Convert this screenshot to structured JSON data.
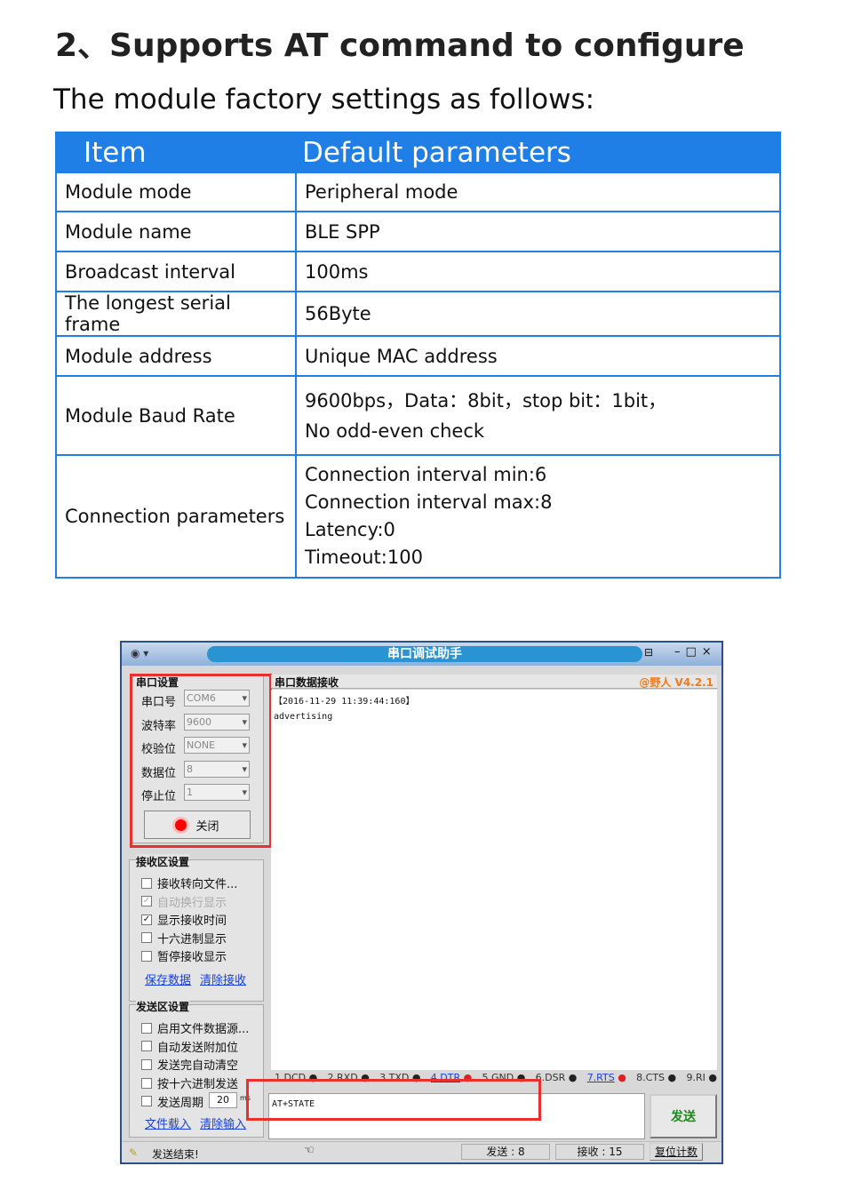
{
  "heading": "2、Supports AT command to configure",
  "subheading": "The module factory settings as follows:",
  "table": {
    "headers": [
      "Item",
      "Default parameters"
    ],
    "rows": [
      {
        "item": "Module mode",
        "value": [
          "Peripheral mode"
        ]
      },
      {
        "item": "Module name",
        "value": [
          "BLE SPP"
        ]
      },
      {
        "item": "Broadcast interval",
        "value": [
          "100ms"
        ]
      },
      {
        "item": "The longest serial frame",
        "value": [
          "56Byte"
        ]
      },
      {
        "item": "Module address",
        "value": [
          "Unique MAC address"
        ]
      },
      {
        "item": "Module Baud Rate",
        "value": [
          "9600bps，Data：8bit，stop bit：1bit，",
          "No odd-even check"
        ]
      },
      {
        "item": "Connection parameters",
        "value": [
          "Connection interval min:6",
          "Connection interval max:8",
          "Latency:0",
          "Timeout:100"
        ]
      }
    ]
  },
  "app": {
    "title": "串口调试助手",
    "version": "@野人 V4.2.1",
    "serial_group": "串口设置",
    "serial_fields": [
      {
        "label": "串口号",
        "value": "COM6"
      },
      {
        "label": "波特率",
        "value": "9600"
      },
      {
        "label": "校验位",
        "value": "NONE"
      },
      {
        "label": "数据位",
        "value": "8"
      },
      {
        "label": "停止位",
        "value": "1"
      }
    ],
    "close_button": "关闭",
    "receive_group": "接收区设置",
    "receive_options": [
      {
        "label": "接收转向文件...",
        "checked": false,
        "disabled": false
      },
      {
        "label": "自动换行显示",
        "checked": true,
        "disabled": true
      },
      {
        "label": "显示接收时间",
        "checked": true,
        "disabled": false
      },
      {
        "label": "十六进制显示",
        "checked": false,
        "disabled": false
      },
      {
        "label": "暂停接收显示",
        "checked": false,
        "disabled": false
      }
    ],
    "receive_links": [
      "保存数据",
      "清除接收"
    ],
    "send_group": "发送区设置",
    "send_options": [
      {
        "label": "启用文件数据源...",
        "checked": false
      },
      {
        "label": "自动发送附加位",
        "checked": false
      },
      {
        "label": "发送完自动清空",
        "checked": false
      },
      {
        "label": "按十六进制发送",
        "checked": false
      },
      {
        "label": "发送周期",
        "checked": false
      }
    ],
    "send_period": "20",
    "send_period_unit": "ms",
    "send_links": [
      "文件载入",
      "清除输入"
    ],
    "receive_title": "串口数据接收",
    "receive_lines": [
      "【2016-11-29 11:39:44:160】",
      "advertising"
    ],
    "pins": [
      {
        "label": "1.DCD",
        "color": "#222222",
        "link": false
      },
      {
        "label": "2.RXD",
        "color": "#222222",
        "link": false
      },
      {
        "label": "3.TXD",
        "color": "#222222",
        "link": false
      },
      {
        "label": "4.DTR",
        "color": "#e02020",
        "link": true
      },
      {
        "label": "5.GND",
        "color": "#222222",
        "link": false
      },
      {
        "label": "6.DSR",
        "color": "#222222",
        "link": false
      },
      {
        "label": "7.RTS",
        "color": "#e02020",
        "link": true
      },
      {
        "label": "8.CTS",
        "color": "#222222",
        "link": false
      },
      {
        "label": "9.RI",
        "color": "#222222",
        "link": false
      }
    ],
    "send_input": "AT+STATE",
    "send_button": "发送",
    "status": "发送结束!",
    "sent_count": "发送 : 8",
    "received_count": "接收 : 15",
    "reset_button": "复位计数",
    "highlight_color": "#e8312f"
  }
}
